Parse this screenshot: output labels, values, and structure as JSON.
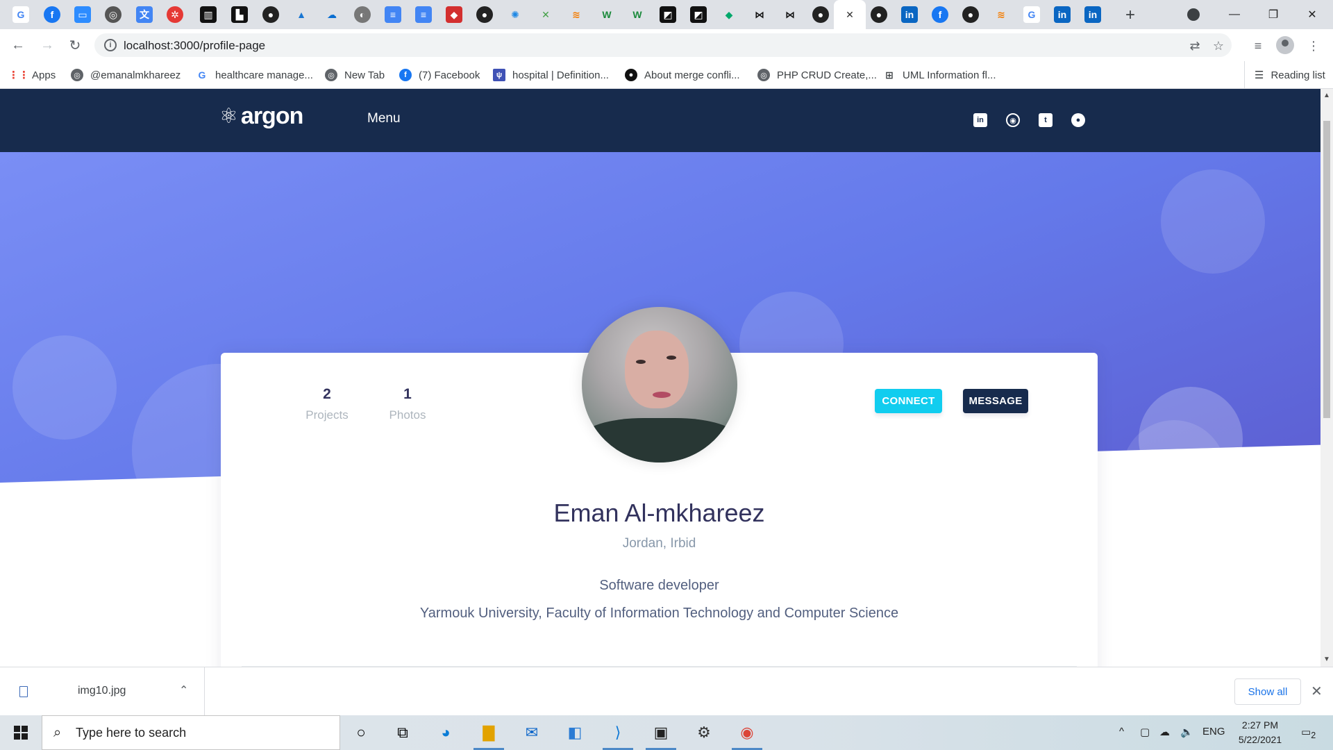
{
  "browser": {
    "url": "localhost:3000/profile-page",
    "bookmarks": [
      "Apps",
      "@emanalmkhareez",
      "healthcare manage...",
      "New Tab",
      "(7) Facebook",
      "hospital | Definition...",
      "About merge confli...",
      "PHP CRUD Create,...",
      "UML Information fl..."
    ],
    "reading_list": "Reading list",
    "new_tab_symbol": "+"
  },
  "site": {
    "brand": "argon",
    "menu": "Menu",
    "social_icons": [
      "linkedin-icon",
      "instagram-icon",
      "twitter-icon",
      "github-icon"
    ]
  },
  "profile": {
    "stats": [
      {
        "value": "2",
        "label": "Projects"
      },
      {
        "value": "1",
        "label": "Photos"
      }
    ],
    "connect_label": "CONNECT",
    "message_label": "MESSAGE",
    "name": "Eman Al-mkhareez",
    "location": "Jordan, Irbid",
    "job": "Software developer",
    "university": "Yarmouk University, Faculty of Information Technology and Computer Science"
  },
  "downloads": {
    "file_name": "img10.jpg",
    "show_all": "Show all"
  },
  "taskbar": {
    "search_placeholder": "Type here to search",
    "language": "ENG",
    "time": "2:27 PM",
    "date": "5/22/2021",
    "notification_count": "2"
  },
  "colors": {
    "navbar": "#172b4d",
    "hero_start": "#7a8ef5",
    "hero_end": "#5a55c9",
    "connect_button": "#11cdef",
    "message_button": "#172b4d"
  }
}
